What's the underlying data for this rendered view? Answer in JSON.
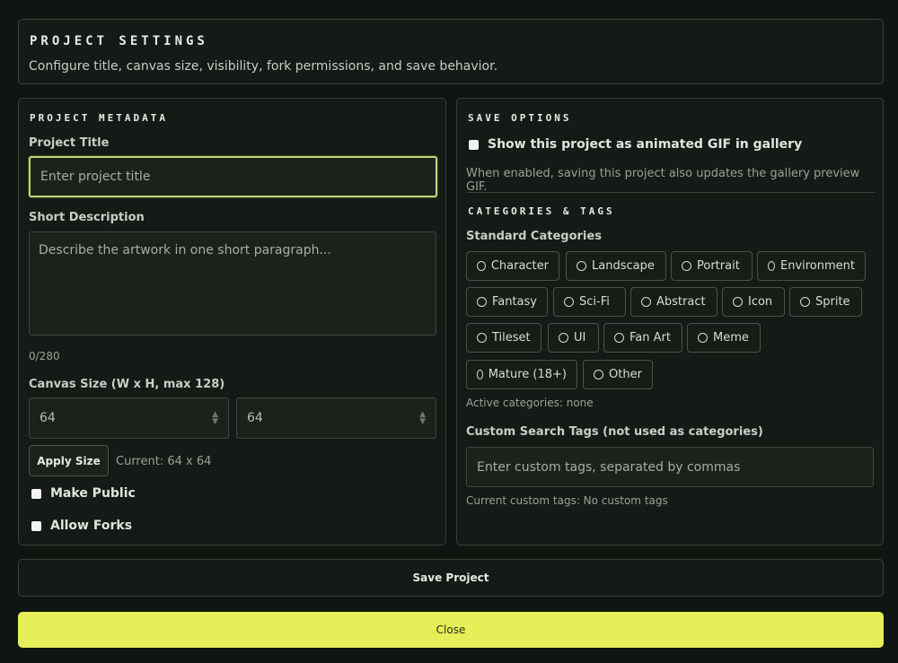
{
  "header": {
    "title": "PROJECT SETTINGS",
    "subtitle": "Configure title, canvas size, visibility, fork permissions, and save behavior."
  },
  "metadata": {
    "section_title": "PROJECT METADATA",
    "title_label": "Project Title",
    "title_placeholder": "Enter project title",
    "desc_label": "Short Description",
    "desc_placeholder": "Describe the artwork in one short paragraph...",
    "char_count": "0/280",
    "canvas_label": "Canvas Size (W x H, max 128)",
    "width_value": "64",
    "height_value": "64",
    "apply_label": "Apply Size",
    "current_size": "Current: 64 x 64",
    "make_public_label": "Make Public",
    "allow_forks_label": "Allow Forks"
  },
  "save_options": {
    "section_title": "SAVE OPTIONS",
    "gif_label": "Show this project as animated GIF in gallery",
    "gif_help": "When enabled, saving this project also updates the gallery preview GIF."
  },
  "categories": {
    "section_title": "CATEGORIES & TAGS",
    "standard_label": "Standard Categories",
    "items": [
      "Character",
      "Landscape",
      "Portrait",
      "Environment",
      "Fantasy",
      "Sci-Fi",
      "Abstract",
      "Icon",
      "Sprite",
      "Tileset",
      "UI",
      "Fan Art",
      "Meme",
      "Mature (18+)",
      "Other"
    ],
    "active_text": "Active categories: none",
    "custom_label": "Custom Search Tags (not used as categories)",
    "custom_placeholder": "Enter custom tags, separated by commas",
    "current_custom": "Current custom tags: No custom tags"
  },
  "footer": {
    "save_label": "Save Project",
    "close_label": "Close"
  },
  "colors": {
    "accent": "#e6ee58",
    "focus_border": "#c7d27a",
    "background": "#0f1510"
  }
}
